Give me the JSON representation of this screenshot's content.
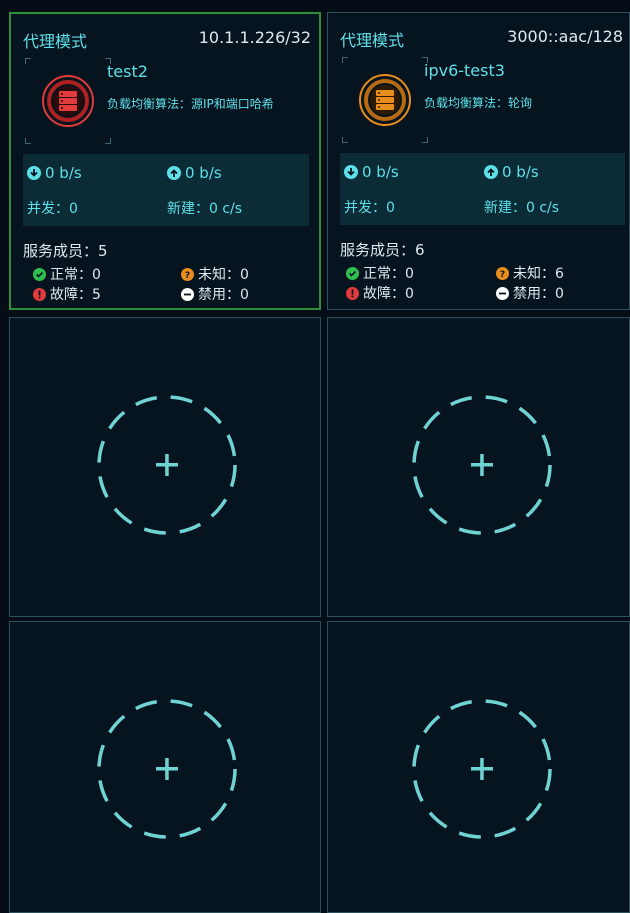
{
  "colors": {
    "accent": "#5ee0e8",
    "ok": "#2fbf4f",
    "fault": "#e23b3b",
    "unknown": "#e88d1e",
    "selected_border": "#2e8f3b"
  },
  "cards": [
    {
      "mode": "代理模式",
      "address": "10.1.1.226/32",
      "name": "test2",
      "algo_label": "负载均衡算法：",
      "algo_value": "源IP和端口哈希",
      "down_rate": "0 b/s",
      "up_rate": "0 b/s",
      "concurrent": "并发：0",
      "new_conn": "新建：0 c/s",
      "members": "服务成员：5",
      "normal": "正常：0",
      "unknown": "未知：0",
      "fault": "故障：5",
      "disabled": "禁用：0",
      "status_color": "#e23b3b"
    },
    {
      "mode": "代理模式",
      "address": "3000::aac/128",
      "name": "ipv6-test3",
      "algo_label": "负载均衡算法：",
      "algo_value": "轮询",
      "down_rate": "0 b/s",
      "up_rate": "0 b/s",
      "concurrent": "并发：0",
      "new_conn": "新建：0 c/s",
      "members": "服务成员：6",
      "normal": "正常：0",
      "unknown": "未知：6",
      "fault": "故障：0",
      "disabled": "禁用：0",
      "status_color": "#e88d1e"
    }
  ],
  "add_icon": "plus-icon"
}
